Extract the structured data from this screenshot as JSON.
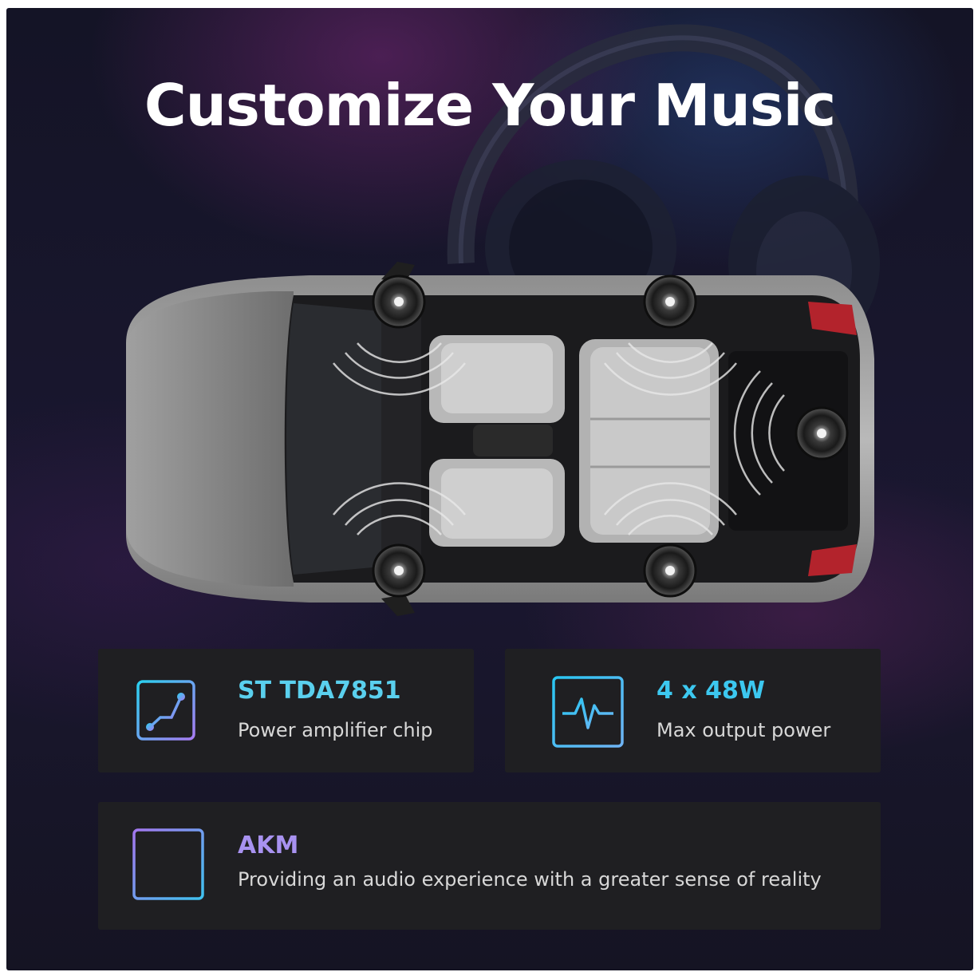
{
  "page": {
    "title": "Customize Your Music"
  },
  "features": [
    {
      "title": "ST TDA7851",
      "subtitle": "Power amplifier chip",
      "icon": "amplifier-chip-icon",
      "title_color": "#5ad0ee"
    },
    {
      "title": "4 x 48W",
      "subtitle": "Max output power",
      "icon": "heartbeat-waveform-icon",
      "title_color": "#3cc8f0"
    },
    {
      "title": "AKM",
      "subtitle": "Providing an audio experience with a greater sense of reality",
      "icon": "audio-bars-icon",
      "title_color": "#a892f0"
    }
  ],
  "colors": {
    "accent_cyan": "#29c6f2",
    "accent_violet": "#9b7af0",
    "card_bg": "#1f1f22"
  }
}
